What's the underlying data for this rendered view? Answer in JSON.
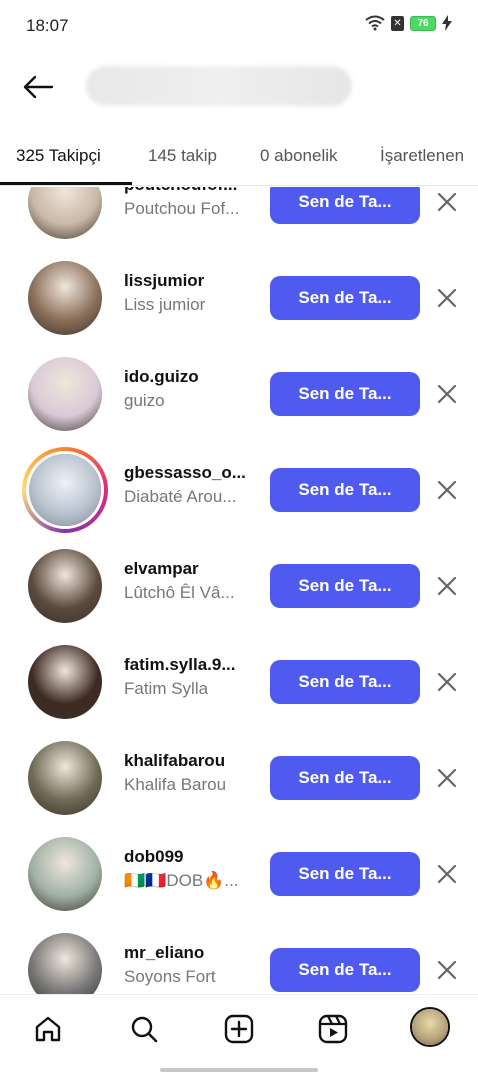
{
  "status_bar": {
    "time": "18:07",
    "battery": "76"
  },
  "header": {
    "back_icon": "arrow-left-icon"
  },
  "tabs": [
    {
      "label": "325 Takipçi",
      "active": true
    },
    {
      "label": "145 takip",
      "active": false
    },
    {
      "label": "0 abonelik",
      "active": false
    },
    {
      "label": "İşaretlenen",
      "active": false
    }
  ],
  "follow_button_label": "Sen de Ta...",
  "users": [
    {
      "username": "poutchoufof...",
      "fullname": "Poutchou Fof...",
      "avatar_color": "#c9b8a6",
      "story_ring": false
    },
    {
      "username": "lissjumior",
      "fullname": "Liss jumior",
      "avatar_color": "#8a6f5a",
      "story_ring": false
    },
    {
      "username": "ido.guizo",
      "fullname": "guizo",
      "avatar_color": "#d9c9d6",
      "story_ring": false
    },
    {
      "username": "gbessasso_o...",
      "fullname": "Diabaté Arou...",
      "avatar_color": "#b9c3cf",
      "story_ring": true
    },
    {
      "username": "elvampar",
      "fullname": "Lûtchô Êl Vâ...",
      "avatar_color": "#5b4a3e",
      "story_ring": false
    },
    {
      "username": "fatim.sylla.9...",
      "fullname": "Fatim Sylla",
      "avatar_color": "#3d2a22",
      "story_ring": false
    },
    {
      "username": "khalifabarou",
      "fullname": "Khalifa Barou",
      "avatar_color": "#6f6a55",
      "story_ring": false
    },
    {
      "username": "dob099",
      "fullname": "🇨🇮🇫🇷DOB🔥...",
      "avatar_color": "#9fb1a4",
      "story_ring": false
    },
    {
      "username": "mr_eliano",
      "fullname": "Soyons Fort",
      "avatar_color": "#777777",
      "story_ring": false
    }
  ],
  "bottom_nav": [
    "home-icon",
    "search-icon",
    "create-icon",
    "reels-icon",
    "profile-avatar"
  ]
}
